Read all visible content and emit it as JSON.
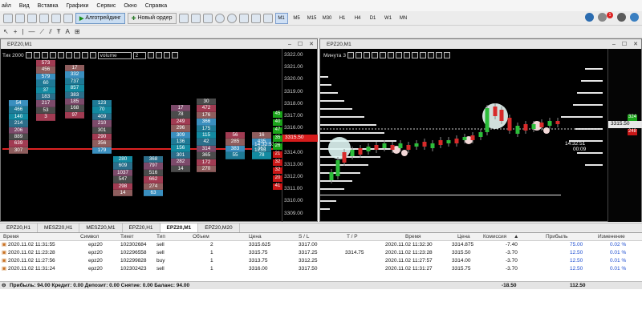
{
  "menu": [
    "айл",
    "Вид",
    "Вставка",
    "Графики",
    "Сервис",
    "Окно",
    "Справка"
  ],
  "toolbar": {
    "algo_label": "Алготрейдинг",
    "new_order_label": "Новый ордер",
    "timeframes": [
      "M1",
      "M5",
      "M15",
      "M30",
      "H1",
      "H4",
      "D1",
      "W1",
      "MN"
    ],
    "active_timeframe": "M1",
    "notif_count": "1"
  },
  "left_chart": {
    "title": "EPZ20,M1",
    "header_label": "Тик",
    "header_value": "2000",
    "select_value": "volume",
    "spin_value": "2",
    "time_label": "14:32:51",
    "vol_label": "1233",
    "current_price": "3315.50",
    "price_axis": [
      "3322.00",
      "3321.00",
      "3320.00",
      "3319.00",
      "3318.00",
      "3317.00",
      "3316.00",
      "3315.00",
      "3314.00",
      "3313.00",
      "3312.00",
      "3311.00",
      "3310.00",
      "3309.00"
    ],
    "green_tags": [
      "45",
      "40",
      "47",
      "35",
      "26"
    ],
    "red_tags": [
      "21",
      "32",
      "32",
      "20",
      "41"
    ]
  },
  "right_chart": {
    "title": "EPZ20,M1",
    "header_label": "Минута",
    "header_value": "3",
    "time_label": "14:32:51",
    "sub_label": "00:09",
    "current_price": "3315.50",
    "green_tag": "324",
    "red_tag": "248"
  },
  "symbol_tabs": [
    "EPZ20,H1",
    "MESZ20,H1",
    "MESZ20,M1",
    "EPZ20,H1",
    "EPZ20,M1",
    "EPZ20,M20"
  ],
  "active_tab": "EPZ20,M1",
  "trades_table": {
    "headers": [
      "Время",
      "Символ",
      "Тикет",
      "Тип",
      "Объем",
      "Цена",
      "S / L",
      "T / P",
      "Время",
      "Цена",
      "Комиссия",
      "Прибыль",
      "Изменение"
    ],
    "rows": [
      {
        "time": "2020.11.02 11:31:55",
        "symbol": "epz20",
        "ticket": "102302684",
        "type": "sell",
        "volume": "2",
        "price": "3315.625",
        "sl": "3317.00",
        "tp": "",
        "ctime": "2020.11.02 11:32:30",
        "cprice": "3314.875",
        "commission": "-7.40",
        "profit": "75.00",
        "change": "0.02 %"
      },
      {
        "time": "2020.11.02 11:23:28",
        "symbol": "epz20",
        "ticket": "102296558",
        "type": "sell",
        "volume": "1",
        "price": "3315.75",
        "sl": "3317.25",
        "tp": "3314.75",
        "ctime": "2020.11.02 11:23:28",
        "cprice": "3315.50",
        "commission": "-3.70",
        "profit": "12.50",
        "change": "0.01 %"
      },
      {
        "time": "2020.11.02 11:27:56",
        "symbol": "epz20",
        "ticket": "102299828",
        "type": "buy",
        "volume": "1",
        "price": "3313.75",
        "sl": "3312.25",
        "tp": "",
        "ctime": "2020.11.02 11:27:57",
        "cprice": "3314.00",
        "commission": "-3.70",
        "profit": "12.50",
        "change": "0.01 %"
      },
      {
        "time": "2020.11.02 11:31:24",
        "symbol": "epz20",
        "ticket": "102302423",
        "type": "sell",
        "volume": "1",
        "price": "3316.00",
        "sl": "3317.50",
        "tp": "",
        "ctime": "2020.11.02 11:31:27",
        "cprice": "3315.75",
        "commission": "-3.70",
        "profit": "12.50",
        "change": "0.01 %"
      }
    ],
    "summary": {
      "text": "Прибыль: 94.00  Кредит: 0.00  Депозит: 0.00  Снятие: 0.00  Баланс: 94.00",
      "commission": "-18.50",
      "profit": "112.50"
    }
  },
  "clusters": [
    {
      "cells": [
        "573",
        "456",
        "579",
        "60",
        "37",
        "183",
        "217",
        "53",
        "3"
      ]
    },
    {
      "cells": [
        "17",
        "332",
        "737",
        "857",
        "383",
        "185",
        "168",
        "97"
      ]
    },
    {
      "cells": [
        "54",
        "466",
        "140",
        "214",
        "206",
        "889",
        "639",
        "307"
      ]
    },
    {
      "cells": [
        "123",
        "70",
        "409",
        "210",
        "301",
        "290",
        "356",
        "179"
      ]
    },
    {
      "cells": [
        "280",
        "609",
        "1037",
        "547",
        "298",
        "14"
      ]
    },
    {
      "cells": [
        "368",
        "797",
        "516",
        "662",
        "274",
        "63"
      ]
    },
    {
      "cells": [
        "17",
        "78",
        "249",
        "296",
        "309",
        "136",
        "156",
        "301",
        "282",
        "14"
      ]
    },
    {
      "cells": [
        "30",
        "472",
        "176",
        "366",
        "175",
        "115",
        "42",
        "314",
        "365",
        "172",
        "270"
      ]
    },
    {
      "cells": [
        "56",
        "285",
        "383",
        "55"
      ]
    },
    {
      "cells": [
        "16",
        "435",
        "363",
        "78"
      ]
    }
  ]
}
